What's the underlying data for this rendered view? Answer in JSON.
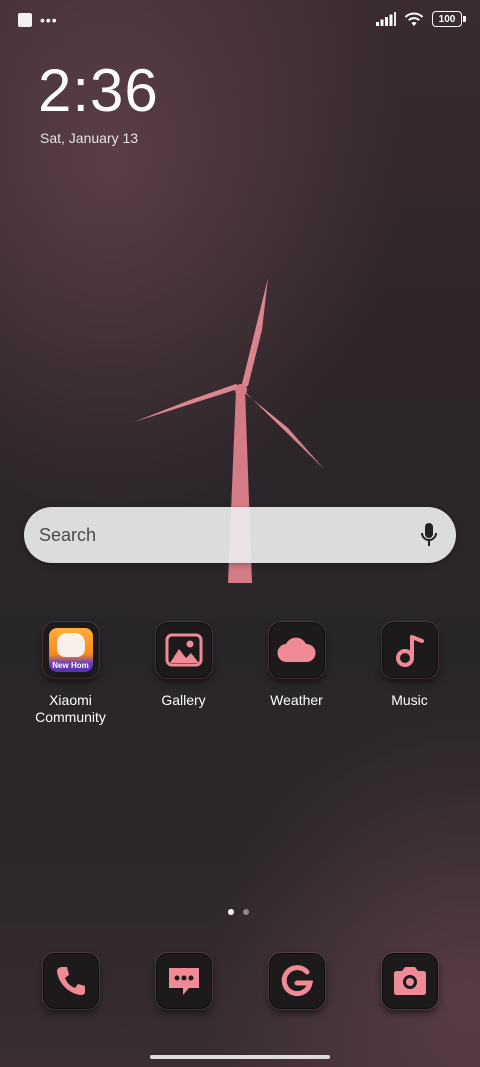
{
  "status_bar": {
    "battery_level": "100"
  },
  "lock": {
    "time": "2:36",
    "date": "Sat, January 13"
  },
  "search": {
    "placeholder": "Search"
  },
  "apps": [
    {
      "label": "Xiaomi Community",
      "icon": "xiaomi-community-icon",
      "badge_text": "New Hom"
    },
    {
      "label": "Gallery",
      "icon": "gallery-icon"
    },
    {
      "label": "Weather",
      "icon": "weather-icon"
    },
    {
      "label": "Music",
      "icon": "music-icon"
    }
  ],
  "page_indicator": {
    "pages": 2,
    "current": 1
  },
  "dock": [
    {
      "icon": "phone-icon"
    },
    {
      "icon": "messages-icon"
    },
    {
      "icon": "google-icon"
    },
    {
      "icon": "camera-icon"
    }
  ],
  "theme": {
    "accent": "#f08a97",
    "icon_bg": "#1d1a1c"
  }
}
